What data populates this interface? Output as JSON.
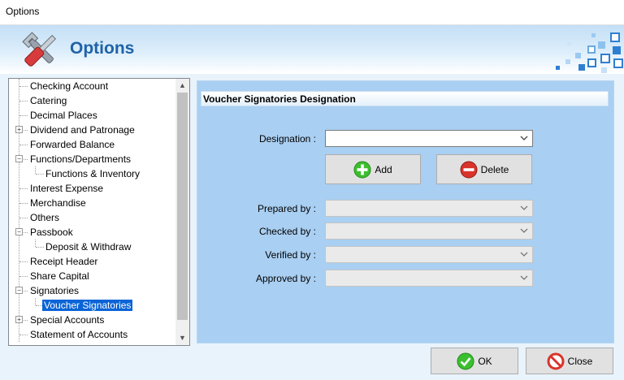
{
  "window": {
    "title": "Options"
  },
  "header": {
    "title": "Options"
  },
  "tree": {
    "items": [
      {
        "label": "Checking Account"
      },
      {
        "label": "Catering"
      },
      {
        "label": "Decimal Places"
      },
      {
        "label": "Dividend and Patronage"
      },
      {
        "label": "Forwarded Balance"
      },
      {
        "label": "Functions/Departments"
      },
      {
        "label": "Functions & Inventory"
      },
      {
        "label": "Interest Expense"
      },
      {
        "label": "Merchandise"
      },
      {
        "label": "Others"
      },
      {
        "label": "Passbook"
      },
      {
        "label": "Deposit & Withdraw"
      },
      {
        "label": "Receipt Header"
      },
      {
        "label": "Share Capital"
      },
      {
        "label": "Signatories"
      },
      {
        "label": "Voucher Signatories"
      },
      {
        "label": "Special Accounts"
      },
      {
        "label": "Statement of Accounts"
      }
    ],
    "selected": "Voucher Signatories"
  },
  "panel": {
    "title": "Voucher Signatories Designation",
    "designation_label": "Designation :",
    "designation_value": "",
    "add_label": "Add",
    "delete_label": "Delete",
    "prepared_label": "Prepared by :",
    "checked_label": "Checked by :",
    "verified_label": "Verified by :",
    "approved_label": "Approved by :"
  },
  "footer": {
    "ok_label": "OK",
    "close_label": "Close"
  },
  "colors": {
    "accent": "#1f63a8",
    "panel": "#a9cff2",
    "selection": "#0a64d6"
  }
}
